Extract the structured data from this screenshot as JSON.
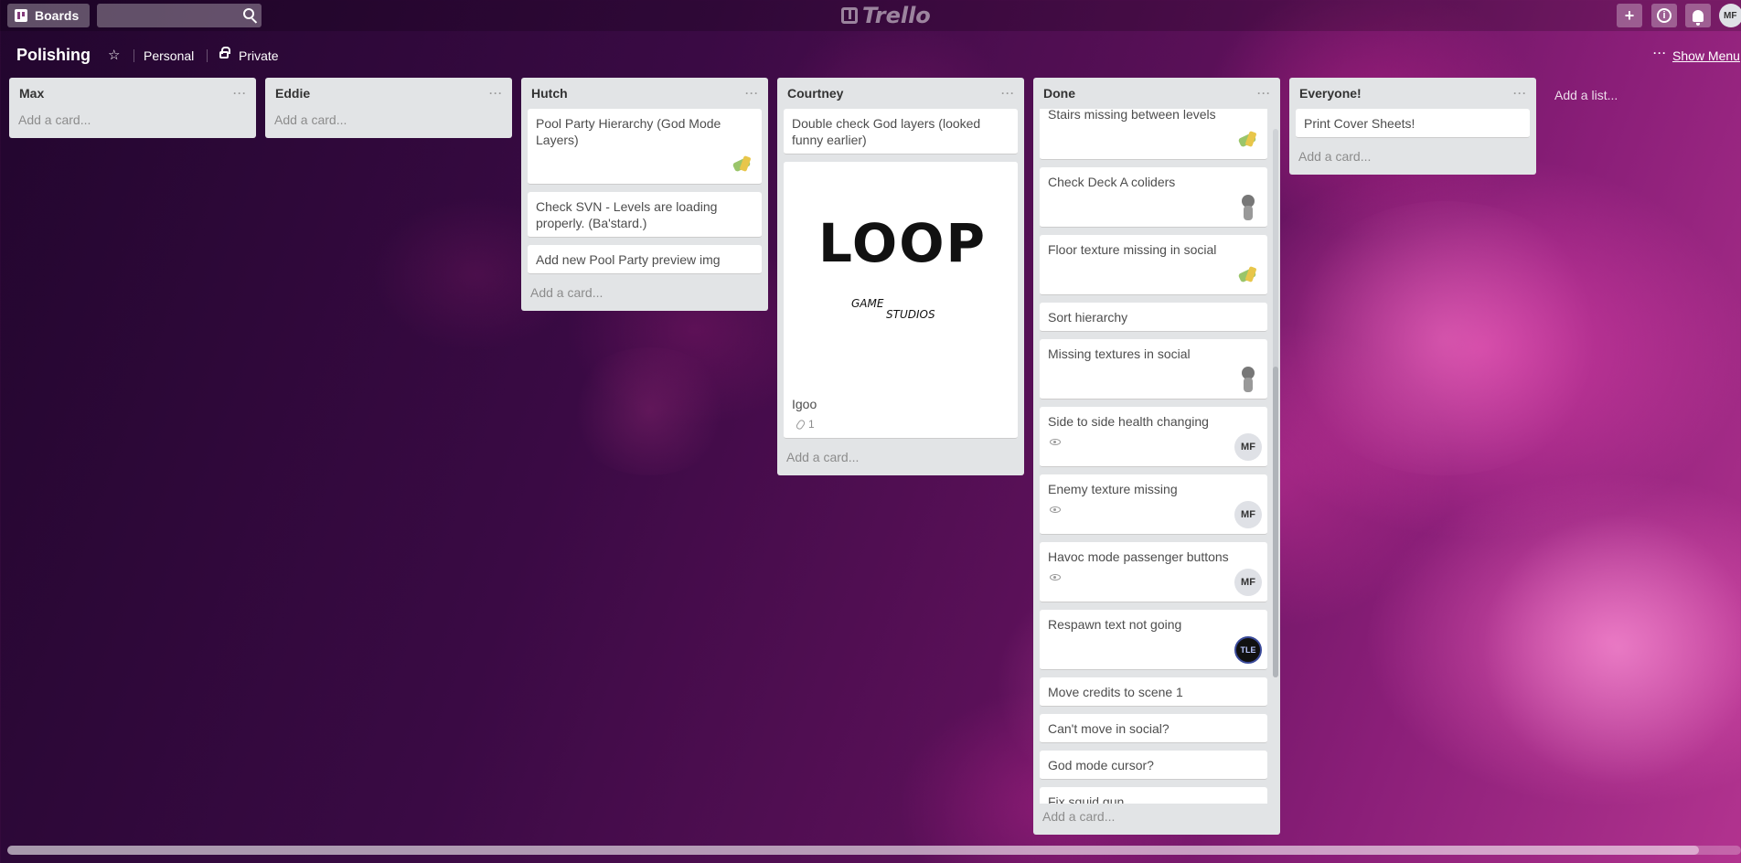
{
  "header": {
    "boards_label": "Boards",
    "logo_text": "Trello",
    "user_initials": "MF"
  },
  "board": {
    "title": "Polishing",
    "team": "Personal",
    "visibility": "Private",
    "show_menu": "Show Menu",
    "add_list": "Add a list..."
  },
  "add_card_label": "Add a card...",
  "lists": [
    {
      "title": "Max"
    },
    {
      "title": "Eddie"
    },
    {
      "title": "Hutch",
      "cards": [
        {
          "text": "Pool Party Hierarchy (God Mode Layers)"
        },
        {
          "text": "Check SVN - Levels are loading properly. (Ba'stard.)"
        },
        {
          "text": "Add new Pool Party preview img"
        }
      ]
    },
    {
      "title": "Courtney",
      "cards": [
        {
          "text": "Double check God layers (looked funny earlier)"
        },
        {
          "text": "Igoo",
          "cover_brand": "LOOP",
          "cover_sub_1": "GAME",
          "cover_sub_2": "STUDIOS",
          "attachments": "1"
        }
      ]
    },
    {
      "title": "Done",
      "cards": [
        {
          "text": "Stairs missing between levels"
        },
        {
          "text": "Check Deck A coliders"
        },
        {
          "text": "Floor texture missing in social"
        },
        {
          "text": "Sort hierarchy"
        },
        {
          "text": "Missing textures in social"
        },
        {
          "text": "Side to side health changing",
          "member": "MF"
        },
        {
          "text": "Enemy texture missing",
          "member": "MF"
        },
        {
          "text": "Havoc mode passenger buttons",
          "member": "MF"
        },
        {
          "text": "Respawn text not going",
          "member": "TLE"
        },
        {
          "text": "Move credits to scene 1"
        },
        {
          "text": "Can't move in social?"
        },
        {
          "text": "God mode cursor?"
        },
        {
          "text": "Fix squid gun"
        }
      ]
    },
    {
      "title": "Everyone!",
      "cards": [
        {
          "text": "Print Cover Sheets!"
        }
      ]
    }
  ],
  "icons": {
    "boards": "boards-icon",
    "search": "search-icon",
    "add": "plus-icon",
    "info": "info-icon",
    "notifications": "bell-icon",
    "star": "star-icon",
    "lock": "lock-icon",
    "menu": "ellipsis-icon",
    "watch": "eye-icon",
    "attachment": "paperclip-icon"
  }
}
